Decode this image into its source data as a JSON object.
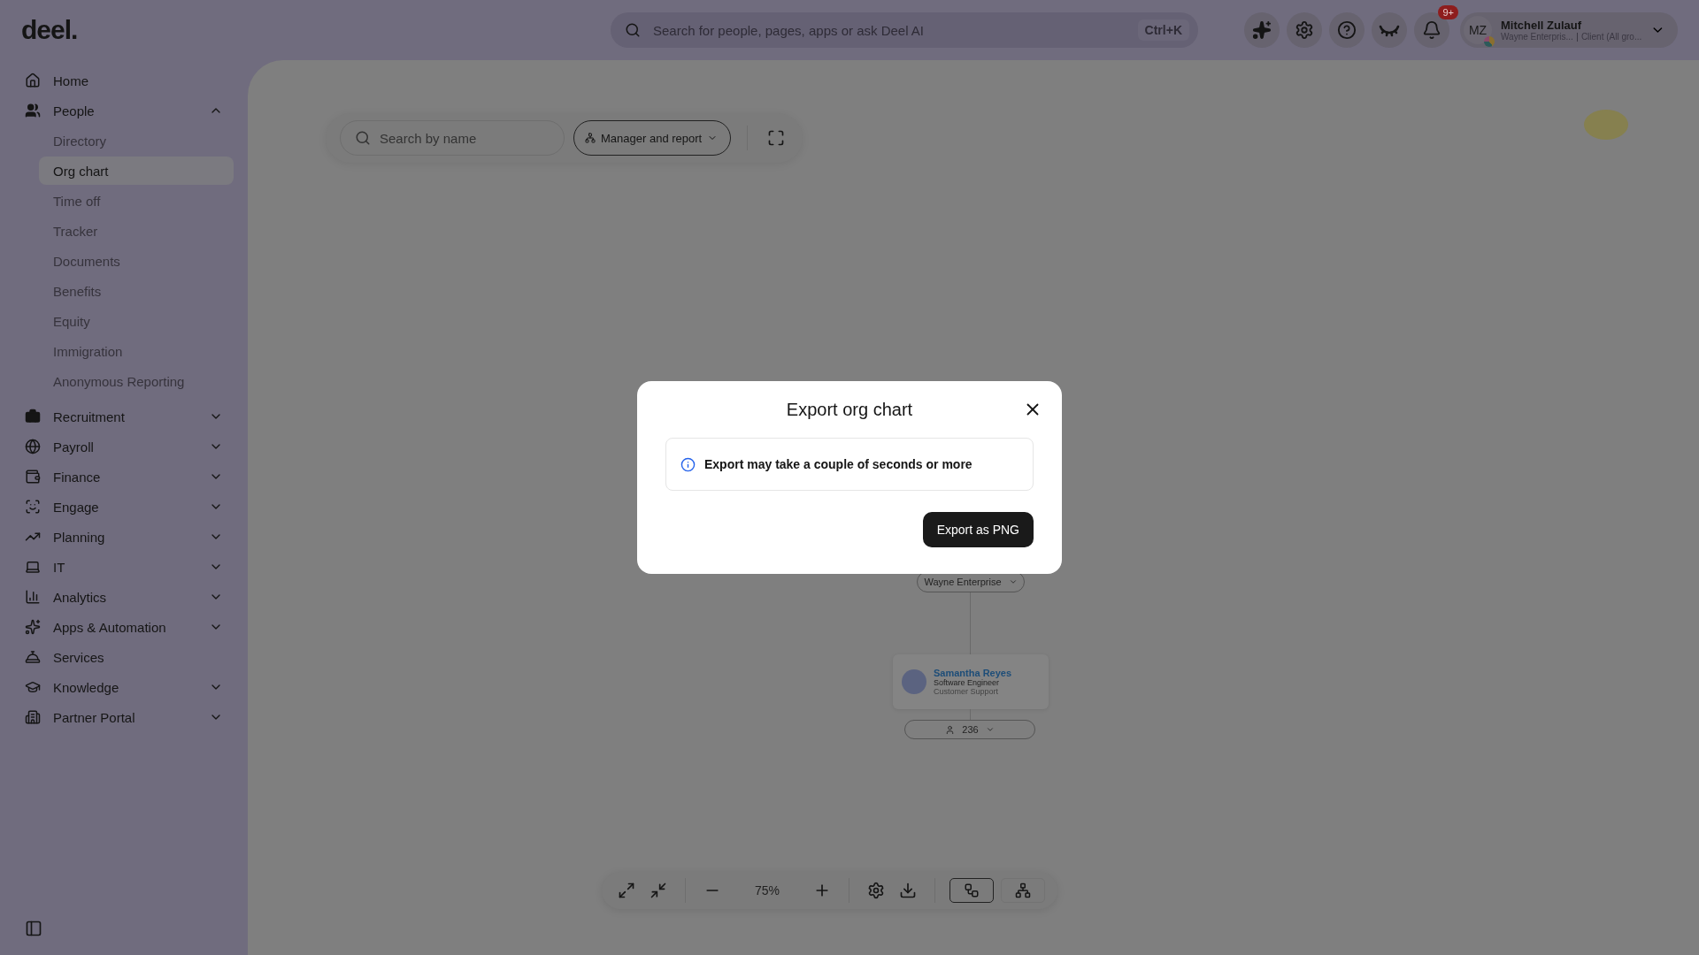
{
  "logo": "deel.",
  "search": {
    "placeholder": "Search for people, pages, apps or ask Deel AI",
    "shortcut": "Ctrl+K"
  },
  "notifications": {
    "badge": "9+"
  },
  "profile": {
    "initials": "MZ",
    "name": "Mitchell Zulauf",
    "company": "Wayne Enterpris...",
    "role": "Client (All gro..."
  },
  "sidebar": {
    "items": [
      {
        "label": "Home"
      },
      {
        "label": "People",
        "expanded": true,
        "children": [
          {
            "label": "Directory",
            "selected": false
          },
          {
            "label": "Org chart",
            "selected": true
          },
          {
            "label": "Time off",
            "selected": false
          },
          {
            "label": "Tracker",
            "selected": false
          },
          {
            "label": "Documents",
            "selected": false
          },
          {
            "label": "Benefits",
            "selected": false
          },
          {
            "label": "Equity",
            "selected": false
          },
          {
            "label": "Immigration",
            "selected": false
          },
          {
            "label": "Anonymous Reporting",
            "selected": false
          }
        ]
      },
      {
        "label": "Recruitment",
        "expanded": false
      },
      {
        "label": "Payroll",
        "expanded": false
      },
      {
        "label": "Finance",
        "expanded": false
      },
      {
        "label": "Engage",
        "expanded": false
      },
      {
        "label": "Planning",
        "expanded": false
      },
      {
        "label": "IT",
        "expanded": false
      },
      {
        "label": "Analytics",
        "expanded": false
      },
      {
        "label": "Apps & Automation",
        "expanded": false
      },
      {
        "label": "Services"
      },
      {
        "label": "Knowledge",
        "expanded": false
      },
      {
        "label": "Partner Portal",
        "expanded": false
      }
    ]
  },
  "chart_toolbar": {
    "search_placeholder": "Search by name",
    "view": "Manager and report"
  },
  "org_chart": {
    "root": "Wayne Enterprise",
    "node": {
      "name": "Samantha Reyes",
      "title": "Software Engineer",
      "department": "Customer Support",
      "reports": "236"
    }
  },
  "zoom_toolbar": {
    "zoom": "75%",
    "view_modes": [
      {
        "selected": true
      },
      {
        "selected": false
      }
    ]
  },
  "dialog": {
    "title": "Export org chart",
    "info": "Export may take a couple of seconds or more",
    "button": "Export as PNG"
  }
}
